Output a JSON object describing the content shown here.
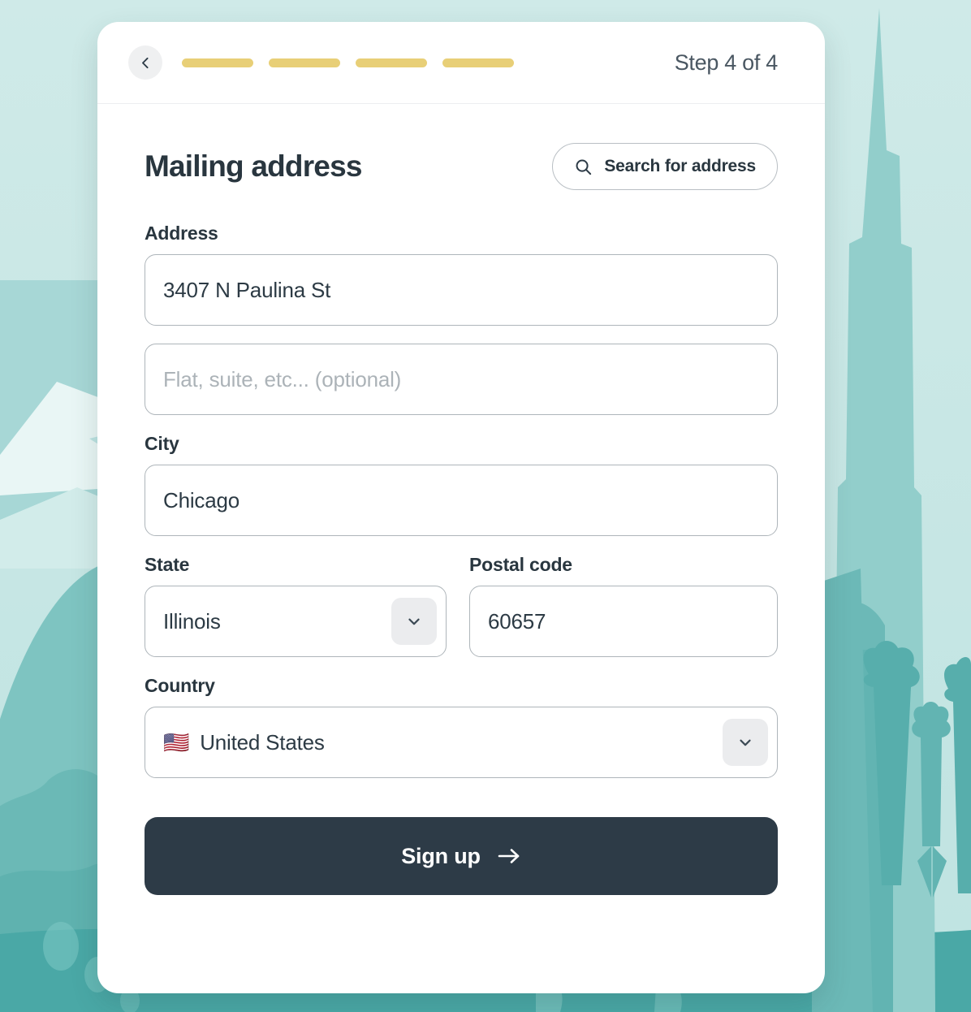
{
  "header": {
    "back_icon": "chevron-left-icon",
    "progress": {
      "total_segments": 4,
      "filled_segments": 4,
      "color": "#e8cf77"
    },
    "step_text": "Step 4 of 4"
  },
  "main": {
    "title": "Mailing address",
    "search_button": {
      "label": "Search for address",
      "icon": "search-icon"
    },
    "fields": {
      "address": {
        "label": "Address",
        "value": "3407 N Paulina St",
        "placeholder": ""
      },
      "address_line2": {
        "label": "",
        "value": "",
        "placeholder": "Flat, suite, etc... (optional)"
      },
      "city": {
        "label": "City",
        "value": "Chicago",
        "placeholder": ""
      },
      "state": {
        "label": "State",
        "value": "Illinois",
        "chevron_icon": "chevron-down-icon"
      },
      "postal_code": {
        "label": "Postal code",
        "value": "60657",
        "placeholder": ""
      },
      "country": {
        "label": "Country",
        "flag": "🇺🇸",
        "value": "United States",
        "chevron_icon": "chevron-down-icon"
      }
    },
    "submit_button": {
      "label": "Sign up",
      "icon": "arrow-right-icon"
    }
  },
  "theme": {
    "accent_yellow": "#e8cf77",
    "dark_navy": "#2d3b47",
    "background_teal": "#c3e5e4",
    "card_white": "#ffffff"
  }
}
